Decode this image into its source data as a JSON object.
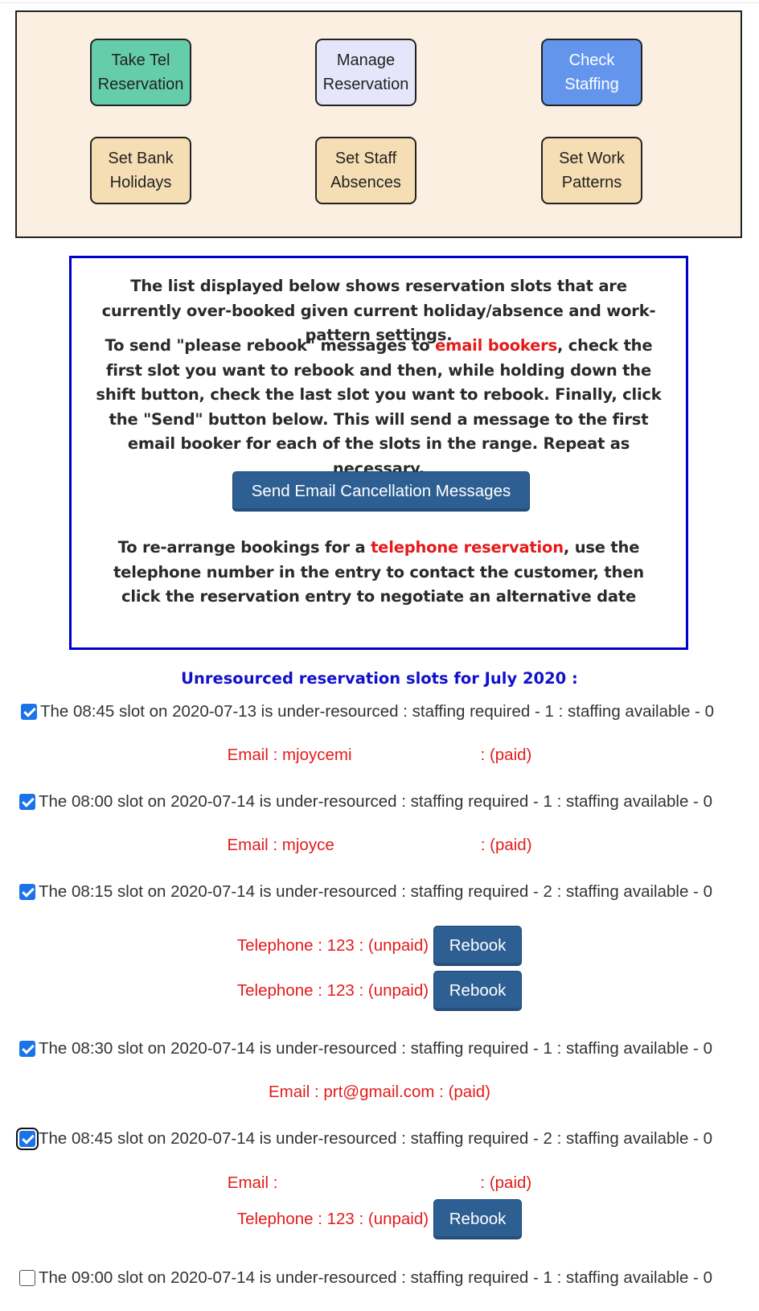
{
  "menu": {
    "take_tel_line1": "Take Tel",
    "take_tel_line2": "Reservation",
    "manage_line1": "Manage",
    "manage_line2": "Reservation",
    "check_line1": "Check",
    "check_line2": "Staffing",
    "bank_line1": "Set Bank",
    "bank_line2": "Holidays",
    "absences_line1": "Set Staff",
    "absences_line2": "Absences",
    "patterns_line1": "Set Work",
    "patterns_line2": "Patterns",
    "colors": {
      "take_tel": "#66cdaa",
      "manage": "#e6e6fa",
      "check": "#6495ed",
      "tan": "#f5deb3"
    }
  },
  "info": {
    "p1": "The list displayed below shows reservation slots that are currently over-booked given current holiday/absence and work-pattern settings.",
    "p2_before": "To send \"please rebook\" messages to ",
    "p2_red": "email bookers",
    "p2_after": ", check the first slot you want to rebook and then, while holding down the shift button, check the last slot you want to rebook. Finally, click the \"Send\" button below. This will send a message to the first email booker for each of the slots in the range. Repeat as necessary.",
    "send_button": "Send Email Cancellation Messages",
    "p3_before": "To re-arrange bookings for a ",
    "p3_red": "telephone reservation",
    "p3_after": ", use the telephone number in the entry to contact the customer, then click the reservation entry to negotiate an alternative date"
  },
  "list_title": "Unresourced reservation slots for July 2020 :",
  "slots": [
    {
      "text": "The 08:45 slot on 2020-07-13 is under-resourced : staffing required - 1 : staffing available - 0",
      "checked": true,
      "details": [
        {
          "label": "Email : mjoycemi",
          "tail": " : (paid)"
        }
      ]
    },
    {
      "text": "The 08:00 slot on 2020-07-14 is under-resourced : staffing required - 1 : staffing available - 0",
      "checked": true,
      "details": [
        {
          "label": "Email : mjoyce",
          "tail": " : (paid)"
        }
      ]
    },
    {
      "text": "The 08:15 slot on 2020-07-14 is under-resourced : staffing required - 2 : staffing available - 0",
      "checked": true,
      "details": [
        {
          "label": "Telephone : 123 : (unpaid)",
          "button": "Rebook"
        },
        {
          "label": "Telephone : 123 : (unpaid)",
          "button": "Rebook"
        }
      ]
    },
    {
      "text": "The 08:30 slot on 2020-07-14 is under-resourced : staffing required - 1 : staffing available - 0",
      "checked": true,
      "details": [
        {
          "label": "Email : prt@gmail.com : (paid)"
        }
      ]
    },
    {
      "text": "The 08:45 slot on 2020-07-14 is under-resourced : staffing required - 2 : staffing available - 0",
      "checked": true,
      "details": [
        {
          "label": "Email :",
          "tail": " : (paid)"
        },
        {
          "label": "Telephone : 123 : (unpaid)",
          "button": "Rebook"
        }
      ]
    },
    {
      "text": "The 09:00 slot on 2020-07-14 is under-resourced : staffing required - 1 : staffing available - 0",
      "checked": false,
      "details": []
    }
  ]
}
